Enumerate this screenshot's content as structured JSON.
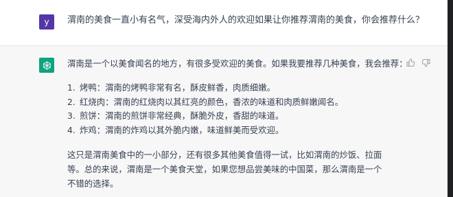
{
  "colors": {
    "user_avatar_bg": "#5436a6",
    "bot_avatar_bg": "#10a37f",
    "bot_row_bg": "#f7f7f8",
    "text": "#374151"
  },
  "user_message": {
    "avatar_letter": "y",
    "text": "渭南的美食一直小有名气，深受海内外人的欢迎如果让你推荐渭南的美食，你会推荐什么？"
  },
  "assistant_message": {
    "avatar_icon": "openai-logo-icon",
    "intro": "渭南是一个以美食闻名的地方，有很多受欢迎的美食。如果我要推荐几种美食，我会推荐：",
    "items": [
      {
        "num": "1.",
        "text": "烤鸭：渭南的烤鸭非常有名，酥皮鲜香，肉质细嫩。"
      },
      {
        "num": "2.",
        "text": "红烧肉：渭南的红烧肉以其红亮的颜色，香浓的味道和肉质鲜嫩闻名。"
      },
      {
        "num": "3.",
        "text": "煎饼：渭南的煎饼非常经典，酥脆外皮，香甜的味道。"
      },
      {
        "num": "4.",
        "text": "炸鸡：渭南的炸鸡以其外脆内嫩，味道鲜美而受欢迎。"
      }
    ],
    "outro": "这只是渭南美食中的一小部分，还有很多其他美食值得一试，比如渭南的炒饭、拉面等。总的来说，渭南是一个美食天堂，如果您想品尝美味的中国菜，那么渭南是一个不错的选择。"
  },
  "feedback": {
    "thumbs_up": "thumbs-up-icon",
    "thumbs_down": "thumbs-down-icon"
  }
}
